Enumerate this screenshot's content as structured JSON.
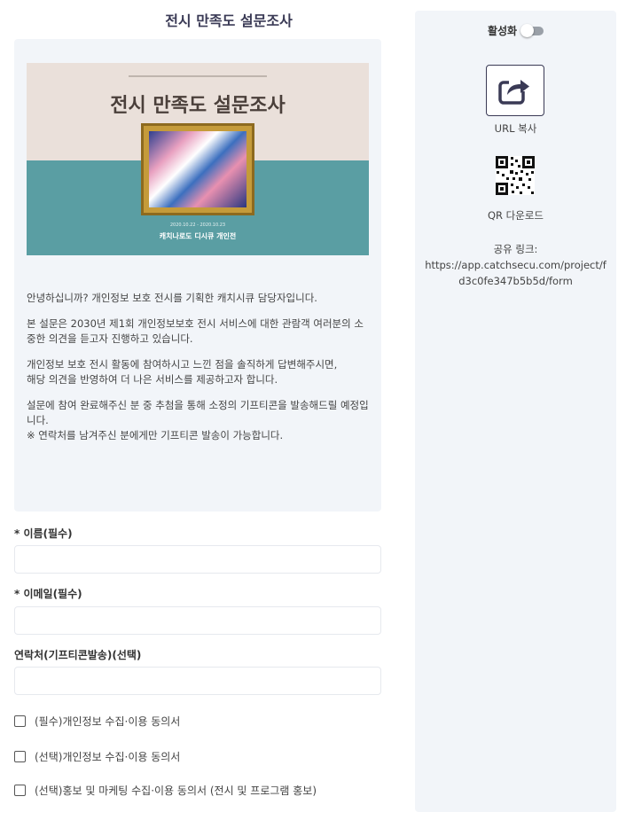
{
  "page": {
    "title": "전시 만족도 설문조사"
  },
  "banner": {
    "title": "전시 만족도 설문조사",
    "dates": "2020.10.22 - 2020.10.23",
    "organizer": "캐치나로도 디시큐 개인전"
  },
  "intro": {
    "paragraphs": [
      "안녕하십니까? 개인정보 보호 전시를 기획한 캐치시큐 담당자입니다.",
      "본 설문은 2030년 제1회 개인정보보호 전시 서비스에 대한 관람객 여러분의 소중한 의견을 듣고자 진행하고 있습니다.",
      "개인정보 보호 전시 활동에 참여하시고 느낀 점을 솔직하게 답변해주시면,\n해당 의견을 반영하여 더 나은 서비스를 제공하고자 합니다.",
      "설문에 참여 완료해주신 분 중 추첨을 통해 소정의 기프티콘을 발송해드릴 예정입니다.\n※ 연락처를 남겨주신 분에게만 기프티콘 발송이 가능합니다."
    ]
  },
  "form": {
    "name_label": "* 이름(필수)",
    "name_value": "",
    "email_label": "* 이메일(필수)",
    "email_value": "",
    "phone_label": "연락처(기프티콘발송)(선택)",
    "phone_value": "",
    "consents": [
      {
        "label": "(필수)개인정보 수집·이용 동의서",
        "checked": false
      },
      {
        "label": "(선택)개인정보 수집·이용 동의서",
        "checked": false
      },
      {
        "label": "(선택)홍보 및 마케팅 수집·이용 동의서 (전시 및 프로그램 홍보)",
        "checked": false
      }
    ]
  },
  "side": {
    "toggle_label": "활성화",
    "toggle_on": false,
    "copy_url_label": "URL 복사",
    "copy_url_icon": "share-arrow-icon",
    "qr_download_label": "QR 다운로드",
    "share_link_label": "공유 링크:",
    "share_link_url": "https://app.catchsecu.com/project/fd3c0fe347b5b5d/form"
  },
  "colors": {
    "panel_bg": "#f2f5f9",
    "accent": "#3a3a55",
    "banner_teal": "#5a9ea3",
    "banner_beige": "#eae0da"
  }
}
